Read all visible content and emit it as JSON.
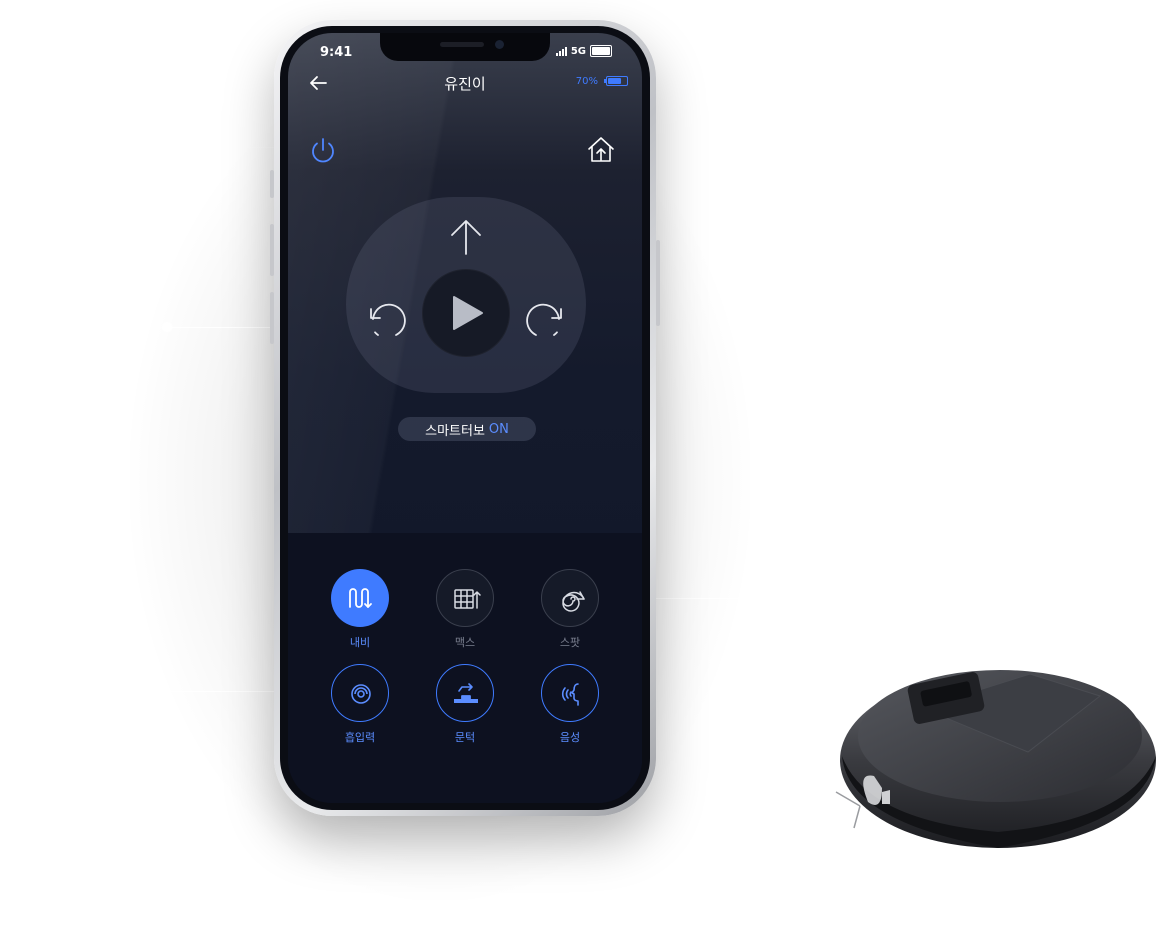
{
  "status_bar": {
    "time": "9:41",
    "network": "5G"
  },
  "header": {
    "title": "유진이"
  },
  "battery": {
    "label": "70%",
    "level": 0.7
  },
  "smart_turbo": {
    "label": "스마트터보",
    "state": "ON"
  },
  "modes_row1": [
    {
      "label": "내비",
      "icon": "zigzag-path-icon",
      "state": "active"
    },
    {
      "label": "맥스",
      "icon": "grid-path-icon",
      "state": "idle"
    },
    {
      "label": "스팟",
      "icon": "spiral-path-icon",
      "state": "idle"
    }
  ],
  "modes_row2": [
    {
      "label": "흡입력",
      "icon": "suction-swirl-icon"
    },
    {
      "label": "문턱",
      "icon": "threshold-climb-icon"
    },
    {
      "label": "음성",
      "icon": "voice-icon"
    }
  ],
  "colors": {
    "accent": "#3f7bff",
    "screen_bg": "#141a2c"
  }
}
